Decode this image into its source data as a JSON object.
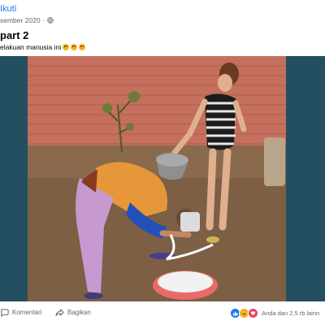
{
  "header": {
    "follow_label": "Ikuti",
    "date": "sember 2020",
    "privacy_icon": "globe-icon"
  },
  "post": {
    "title": "part 2",
    "text": "elakuan manusia ini",
    "emojis": [
      "rofl-emoji",
      "rofl-emoji",
      "rofl-emoji"
    ]
  },
  "video": {
    "description_icon": "video-frame"
  },
  "actions": {
    "comment_label": "Komentari",
    "share_label": "Bagikan"
  },
  "reactions": {
    "icons": [
      "like-icon",
      "haha-icon",
      "love-icon"
    ],
    "summary": "Anda dan 2,5 rb lainn"
  },
  "colors": {
    "accent": "#1877f2",
    "muted": "#65676b",
    "video_bg": "#234f60"
  }
}
